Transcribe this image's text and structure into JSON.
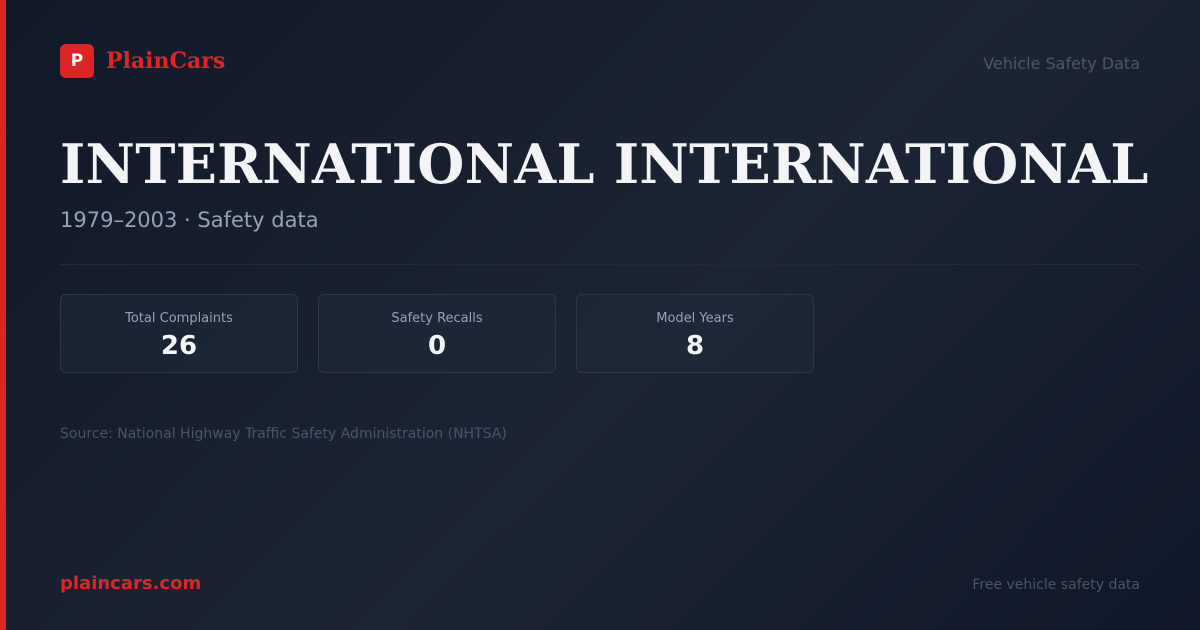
{
  "brand": {
    "logo_letter": "P",
    "name": "PlainCars"
  },
  "header": {
    "tagline": "Vehicle Safety Data"
  },
  "vehicle": {
    "title": "INTERNATIONAL INTERNATIONAL",
    "subtitle": "1979–2003 · Safety data"
  },
  "stats": [
    {
      "label": "Total Complaints",
      "value": "26"
    },
    {
      "label": "Safety Recalls",
      "value": "0"
    },
    {
      "label": "Model Years",
      "value": "8"
    }
  ],
  "source": "Source: National Highway Traffic Safety Administration (NHTSA)",
  "footer": {
    "domain": "plaincars.com",
    "note": "Free vehicle safety data"
  },
  "colors": {
    "accent": "#dc2626",
    "background": "#111827",
    "text_primary": "#f3f4f6",
    "text_muted": "#94a3b8"
  }
}
